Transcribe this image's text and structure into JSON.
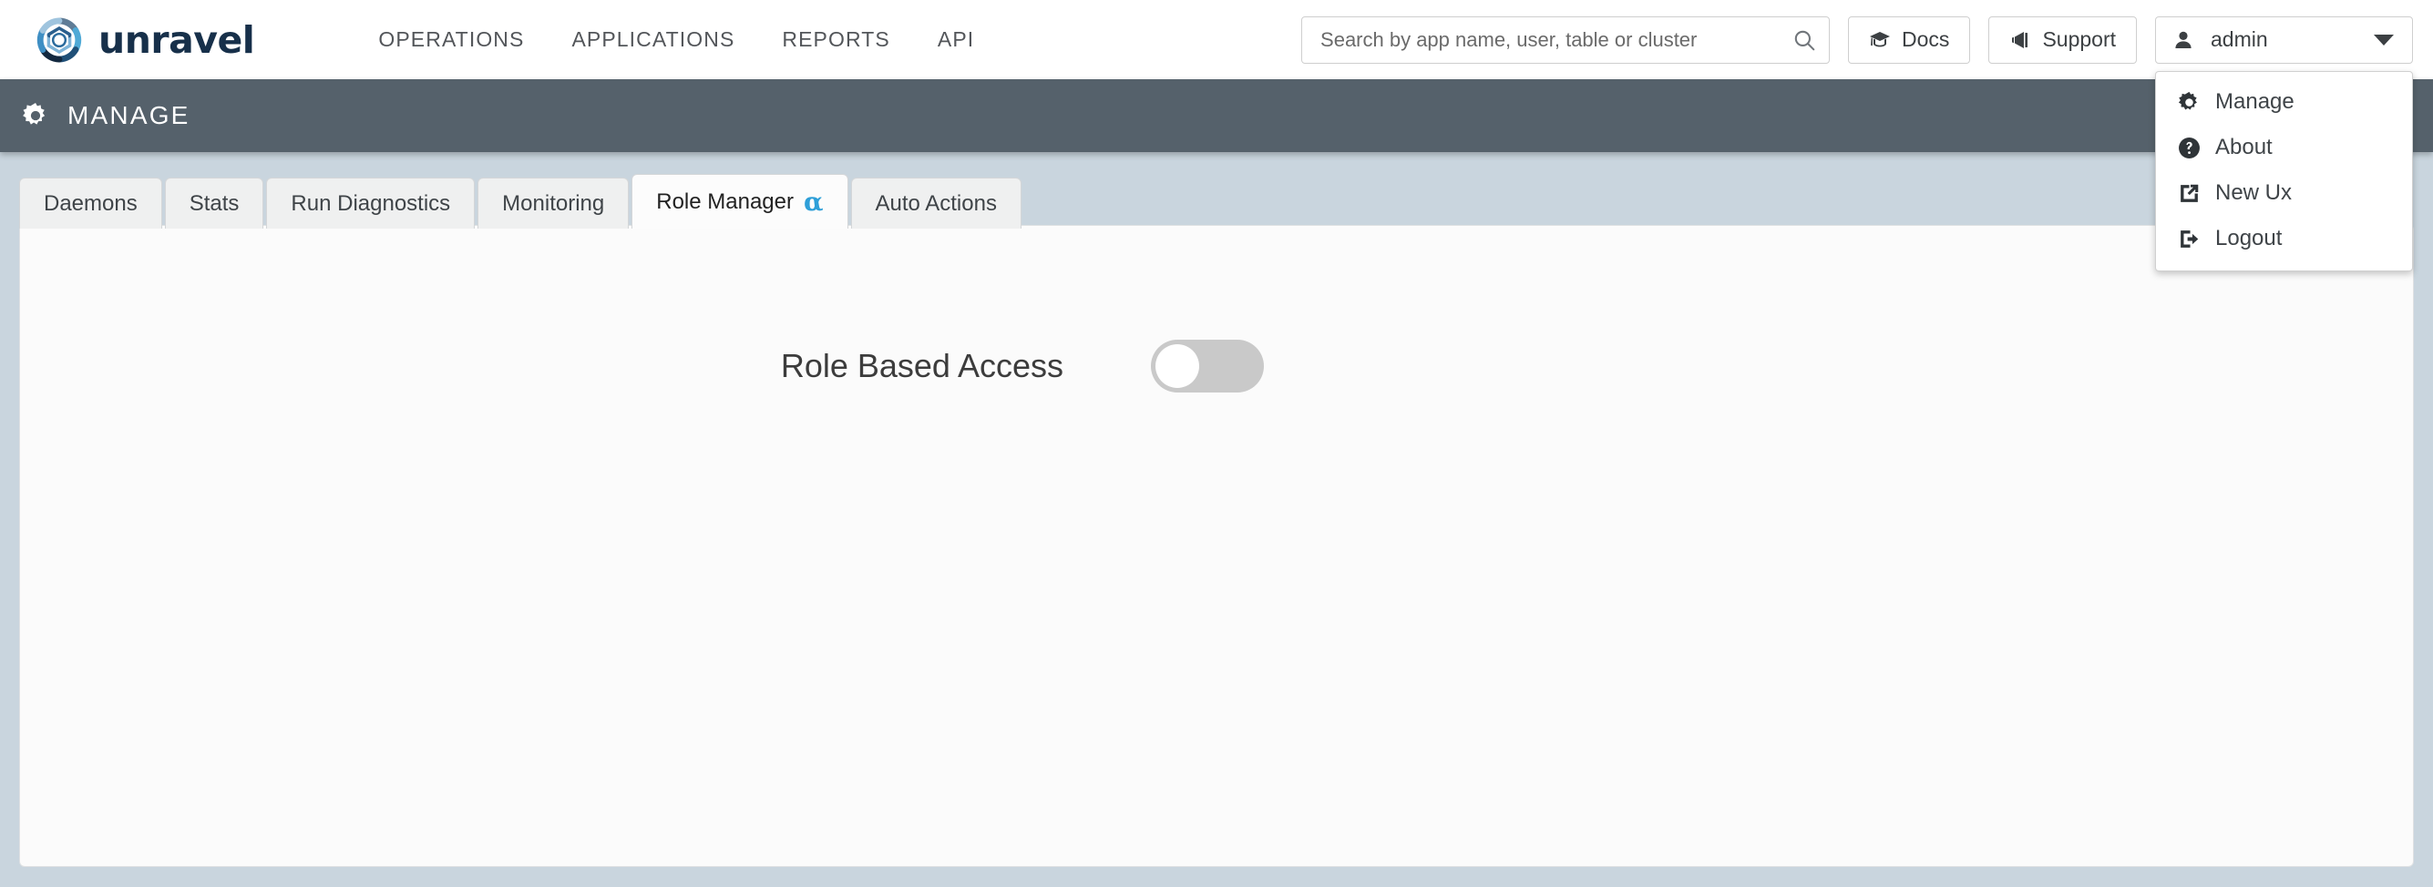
{
  "brand": {
    "name": "unravel",
    "logo_icon": "unravel-knot-logo"
  },
  "topnav": {
    "items": [
      {
        "label": "OPERATIONS"
      },
      {
        "label": "APPLICATIONS"
      },
      {
        "label": "REPORTS"
      },
      {
        "label": "API"
      }
    ]
  },
  "search": {
    "placeholder": "Search by app name, user, table or cluster",
    "value": "",
    "icon": "search-icon"
  },
  "actions": {
    "docs_label": "Docs",
    "docs_icon": "graduation-cap-icon",
    "support_label": "Support",
    "support_icon": "megaphone-icon",
    "admin_label": "admin",
    "admin_icon": "user-icon",
    "caret_icon": "chevron-down-icon"
  },
  "user_menu": {
    "open": true,
    "items": [
      {
        "label": "Manage",
        "icon": "gear-icon"
      },
      {
        "label": "About",
        "icon": "question-circle-icon"
      },
      {
        "label": "New Ux",
        "icon": "external-link-icon"
      },
      {
        "label": "Logout",
        "icon": "sign-out-icon"
      }
    ]
  },
  "page_header": {
    "title": "MANAGE",
    "icon": "gear-icon"
  },
  "tabs": [
    {
      "label": "Daemons",
      "active": false,
      "badge": ""
    },
    {
      "label": "Stats",
      "active": false,
      "badge": ""
    },
    {
      "label": "Run Diagnostics",
      "active": false,
      "badge": ""
    },
    {
      "label": "Monitoring",
      "active": false,
      "badge": ""
    },
    {
      "label": "Role Manager",
      "active": true,
      "badge": "α"
    },
    {
      "label": "Auto Actions",
      "active": false,
      "badge": ""
    }
  ],
  "content": {
    "role_based_access_label": "Role Based Access",
    "role_based_access_enabled": false
  },
  "colors": {
    "page_background": "#c9d5de",
    "header_bar": "#55616b",
    "accent_blue": "#2e9fd8",
    "panel_background": "#fbfbfb",
    "tab_inactive": "#eff0f0",
    "toggle_off_track": "#c9c9c9"
  }
}
